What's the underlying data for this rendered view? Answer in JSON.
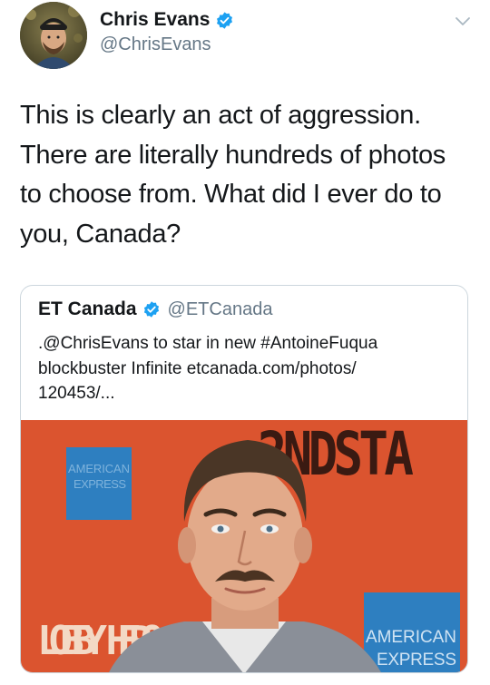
{
  "author": {
    "name": "Chris Evans",
    "handle": "@ChrisEvans"
  },
  "tweet": {
    "lines": [
      "This is clearly an act of aggression.",
      "There are literally hundreds of photos",
      "to choose from. What did I ever do to",
      "you, Canada?"
    ]
  },
  "quoted": {
    "name": "ET Canada",
    "handle": "@ETCanada",
    "lines": [
      ".@ChrisEvans to star in new #AntoineFuqua",
      "blockbuster Infinite etcanada.com/photos/",
      "120453/..."
    ],
    "image": {
      "backdrop_text_top": "2NDSTA",
      "backdrop_text_left": "LOBBY HERO",
      "logo_text_1": "AMERICAN",
      "logo_text_2": "EXPRESS",
      "backdrop_color": "#d94e2a"
    }
  },
  "colors": {
    "verified_blue": "#1da1f2",
    "secondary_text": "#657786",
    "border": "#ccd6dd"
  },
  "icons": {
    "verified": "verified-badge-icon",
    "caret": "chevron-down-icon"
  }
}
